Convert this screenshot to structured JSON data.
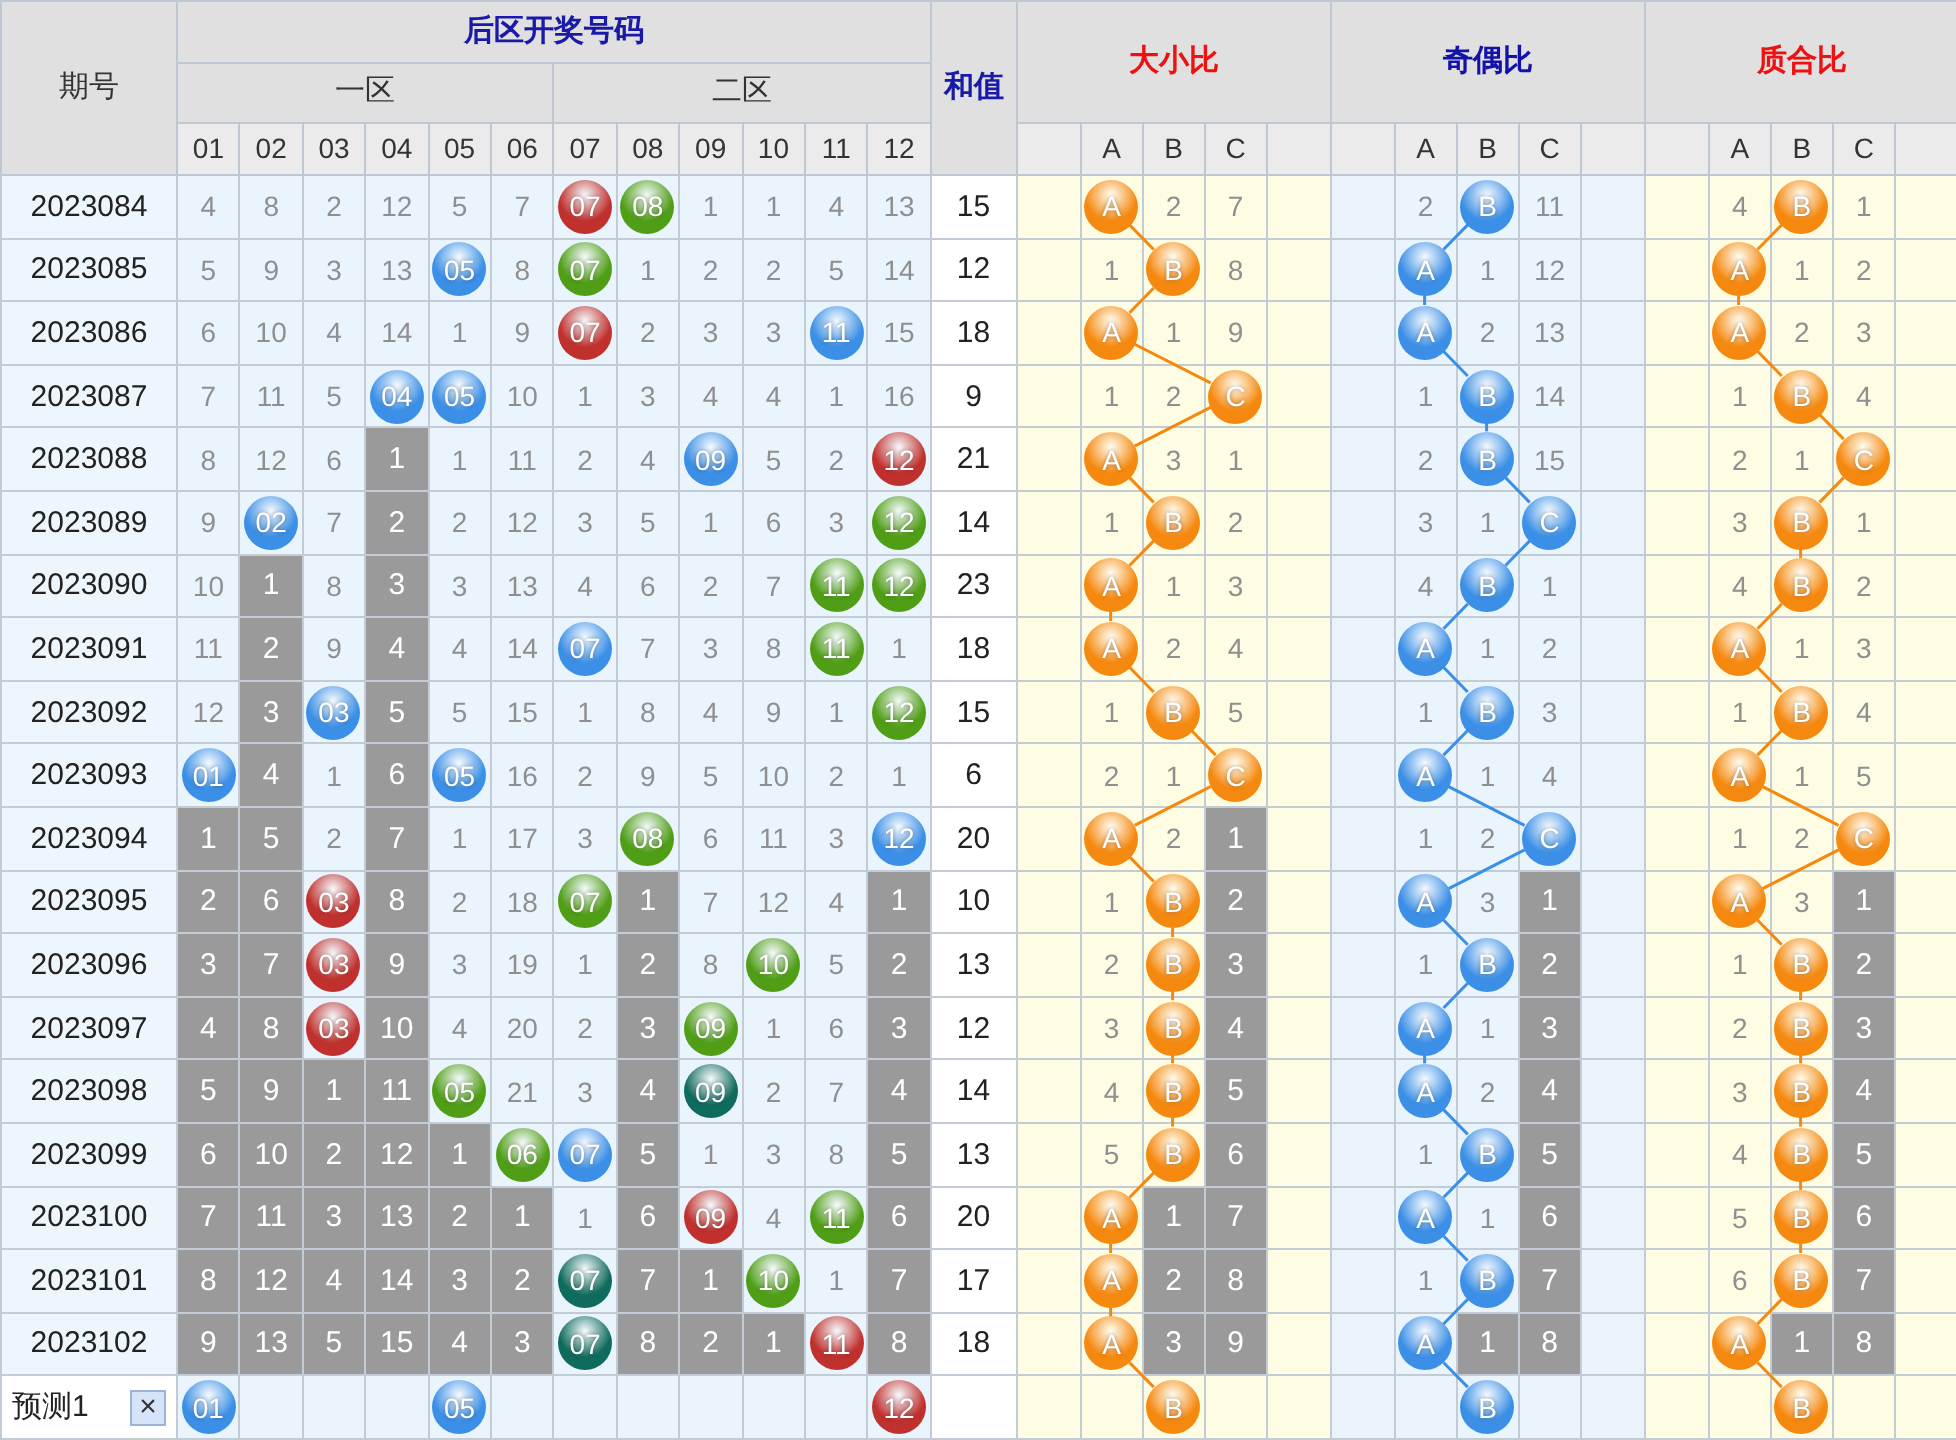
{
  "header": {
    "period": "期号",
    "draw_title": "后区开奖号码",
    "zones": [
      {
        "label": "一区"
      },
      {
        "label": "二区"
      }
    ],
    "numbers": [
      "01",
      "02",
      "03",
      "04",
      "05",
      "06",
      "07",
      "08",
      "09",
      "10",
      "11",
      "12"
    ],
    "sum": "和值"
  },
  "groups": [
    {
      "title": "大小比",
      "kind": "warm",
      "color": "#f5880f",
      "columns": [
        "A",
        "B",
        "C"
      ]
    },
    {
      "title": "奇偶比",
      "kind": "cool",
      "color": "#3b8fe6",
      "columns": [
        "A",
        "B",
        "C"
      ]
    },
    {
      "title": "质合比",
      "kind": "warm",
      "color": "#f5880f",
      "columns": [
        "A",
        "B",
        "C"
      ]
    }
  ],
  "rows": [
    {
      "period": "2023084",
      "cells": [
        {
          "kind": "miss",
          "text": "4"
        },
        {
          "kind": "miss",
          "text": "8"
        },
        {
          "kind": "miss",
          "text": "2"
        },
        {
          "kind": "miss",
          "text": "12"
        },
        {
          "kind": "miss",
          "text": "5"
        },
        {
          "kind": "miss",
          "text": "7"
        },
        {
          "kind": "ball",
          "text": "07",
          "color": "#c0312e"
        },
        {
          "kind": "ball",
          "text": "08",
          "color": "#4f9e16"
        },
        {
          "kind": "miss",
          "text": "1"
        },
        {
          "kind": "miss",
          "text": "1"
        },
        {
          "kind": "miss",
          "text": "4"
        },
        {
          "kind": "miss",
          "text": "13"
        }
      ],
      "sum": "15",
      "ratios": [
        [
          {
            "kind": "ball",
            "text": "A"
          },
          {
            "kind": "miss",
            "text": "2"
          },
          {
            "kind": "miss",
            "text": "7"
          }
        ],
        [
          {
            "kind": "miss",
            "text": "2"
          },
          {
            "kind": "ball",
            "text": "B"
          },
          {
            "kind": "miss",
            "text": "11"
          }
        ],
        [
          {
            "kind": "miss",
            "text": "4"
          },
          {
            "kind": "ball",
            "text": "B"
          },
          {
            "kind": "miss",
            "text": "1"
          }
        ]
      ]
    },
    {
      "period": "2023085",
      "cells": [
        {
          "kind": "miss",
          "text": "5"
        },
        {
          "kind": "miss",
          "text": "9"
        },
        {
          "kind": "miss",
          "text": "3"
        },
        {
          "kind": "miss",
          "text": "13"
        },
        {
          "kind": "ball",
          "text": "05",
          "color": "#3b8fe6"
        },
        {
          "kind": "miss",
          "text": "8"
        },
        {
          "kind": "ball",
          "text": "07",
          "color": "#4f9e16"
        },
        {
          "kind": "miss",
          "text": "1"
        },
        {
          "kind": "miss",
          "text": "2"
        },
        {
          "kind": "miss",
          "text": "2"
        },
        {
          "kind": "miss",
          "text": "5"
        },
        {
          "kind": "miss",
          "text": "14"
        }
      ],
      "sum": "12",
      "ratios": [
        [
          {
            "kind": "miss",
            "text": "1"
          },
          {
            "kind": "ball",
            "text": "B"
          },
          {
            "kind": "miss",
            "text": "8"
          }
        ],
        [
          {
            "kind": "ball",
            "text": "A"
          },
          {
            "kind": "miss",
            "text": "1"
          },
          {
            "kind": "miss",
            "text": "12"
          }
        ],
        [
          {
            "kind": "ball",
            "text": "A"
          },
          {
            "kind": "miss",
            "text": "1"
          },
          {
            "kind": "miss",
            "text": "2"
          }
        ]
      ]
    },
    {
      "period": "2023086",
      "cells": [
        {
          "kind": "miss",
          "text": "6"
        },
        {
          "kind": "miss",
          "text": "10"
        },
        {
          "kind": "miss",
          "text": "4"
        },
        {
          "kind": "miss",
          "text": "14"
        },
        {
          "kind": "miss",
          "text": "1"
        },
        {
          "kind": "miss",
          "text": "9"
        },
        {
          "kind": "ball",
          "text": "07",
          "color": "#c0312e"
        },
        {
          "kind": "miss",
          "text": "2"
        },
        {
          "kind": "miss",
          "text": "3"
        },
        {
          "kind": "miss",
          "text": "3"
        },
        {
          "kind": "ball",
          "text": "11",
          "color": "#3b8fe6"
        },
        {
          "kind": "miss",
          "text": "15"
        }
      ],
      "sum": "18",
      "ratios": [
        [
          {
            "kind": "ball",
            "text": "A"
          },
          {
            "kind": "miss",
            "text": "1"
          },
          {
            "kind": "miss",
            "text": "9"
          }
        ],
        [
          {
            "kind": "ball",
            "text": "A"
          },
          {
            "kind": "miss",
            "text": "2"
          },
          {
            "kind": "miss",
            "text": "13"
          }
        ],
        [
          {
            "kind": "ball",
            "text": "A"
          },
          {
            "kind": "miss",
            "text": "2"
          },
          {
            "kind": "miss",
            "text": "3"
          }
        ]
      ]
    },
    {
      "period": "2023087",
      "cells": [
        {
          "kind": "miss",
          "text": "7"
        },
        {
          "kind": "miss",
          "text": "11"
        },
        {
          "kind": "miss",
          "text": "5"
        },
        {
          "kind": "ball",
          "text": "04",
          "color": "#3b8fe6"
        },
        {
          "kind": "ball",
          "text": "05",
          "color": "#3b8fe6"
        },
        {
          "kind": "miss",
          "text": "10"
        },
        {
          "kind": "miss",
          "text": "1"
        },
        {
          "kind": "miss",
          "text": "3"
        },
        {
          "kind": "miss",
          "text": "4"
        },
        {
          "kind": "miss",
          "text": "4"
        },
        {
          "kind": "miss",
          "text": "1"
        },
        {
          "kind": "miss",
          "text": "16"
        }
      ],
      "sum": "9",
      "ratios": [
        [
          {
            "kind": "miss",
            "text": "1"
          },
          {
            "kind": "miss",
            "text": "2"
          },
          {
            "kind": "ball",
            "text": "C"
          }
        ],
        [
          {
            "kind": "miss",
            "text": "1"
          },
          {
            "kind": "ball",
            "text": "B"
          },
          {
            "kind": "miss",
            "text": "14"
          }
        ],
        [
          {
            "kind": "miss",
            "text": "1"
          },
          {
            "kind": "ball",
            "text": "B"
          },
          {
            "kind": "miss",
            "text": "4"
          }
        ]
      ]
    },
    {
      "period": "2023088",
      "cells": [
        {
          "kind": "miss",
          "text": "8"
        },
        {
          "kind": "miss",
          "text": "12"
        },
        {
          "kind": "miss",
          "text": "6"
        },
        {
          "kind": "streak",
          "text": "1"
        },
        {
          "kind": "miss",
          "text": "1"
        },
        {
          "kind": "miss",
          "text": "11"
        },
        {
          "kind": "miss",
          "text": "2"
        },
        {
          "kind": "miss",
          "text": "4"
        },
        {
          "kind": "ball",
          "text": "09",
          "color": "#3b8fe6"
        },
        {
          "kind": "miss",
          "text": "5"
        },
        {
          "kind": "miss",
          "text": "2"
        },
        {
          "kind": "ball",
          "text": "12",
          "color": "#c0312e"
        }
      ],
      "sum": "21",
      "ratios": [
        [
          {
            "kind": "ball",
            "text": "A"
          },
          {
            "kind": "miss",
            "text": "3"
          },
          {
            "kind": "miss",
            "text": "1"
          }
        ],
        [
          {
            "kind": "miss",
            "text": "2"
          },
          {
            "kind": "ball",
            "text": "B"
          },
          {
            "kind": "miss",
            "text": "15"
          }
        ],
        [
          {
            "kind": "miss",
            "text": "2"
          },
          {
            "kind": "miss",
            "text": "1"
          },
          {
            "kind": "ball",
            "text": "C"
          }
        ]
      ]
    },
    {
      "period": "2023089",
      "cells": [
        {
          "kind": "miss",
          "text": "9"
        },
        {
          "kind": "ball",
          "text": "02",
          "color": "#3b8fe6"
        },
        {
          "kind": "miss",
          "text": "7"
        },
        {
          "kind": "streak",
          "text": "2"
        },
        {
          "kind": "miss",
          "text": "2"
        },
        {
          "kind": "miss",
          "text": "12"
        },
        {
          "kind": "miss",
          "text": "3"
        },
        {
          "kind": "miss",
          "text": "5"
        },
        {
          "kind": "miss",
          "text": "1"
        },
        {
          "kind": "miss",
          "text": "6"
        },
        {
          "kind": "miss",
          "text": "3"
        },
        {
          "kind": "ball",
          "text": "12",
          "color": "#4f9e16"
        }
      ],
      "sum": "14",
      "ratios": [
        [
          {
            "kind": "miss",
            "text": "1"
          },
          {
            "kind": "ball",
            "text": "B"
          },
          {
            "kind": "miss",
            "text": "2"
          }
        ],
        [
          {
            "kind": "miss",
            "text": "3"
          },
          {
            "kind": "miss",
            "text": "1"
          },
          {
            "kind": "ball",
            "text": "C"
          }
        ],
        [
          {
            "kind": "miss",
            "text": "3"
          },
          {
            "kind": "ball",
            "text": "B"
          },
          {
            "kind": "miss",
            "text": "1"
          }
        ]
      ]
    },
    {
      "period": "2023090",
      "cells": [
        {
          "kind": "miss",
          "text": "10"
        },
        {
          "kind": "streak",
          "text": "1"
        },
        {
          "kind": "miss",
          "text": "8"
        },
        {
          "kind": "streak",
          "text": "3"
        },
        {
          "kind": "miss",
          "text": "3"
        },
        {
          "kind": "miss",
          "text": "13"
        },
        {
          "kind": "miss",
          "text": "4"
        },
        {
          "kind": "miss",
          "text": "6"
        },
        {
          "kind": "miss",
          "text": "2"
        },
        {
          "kind": "miss",
          "text": "7"
        },
        {
          "kind": "ball",
          "text": "11",
          "color": "#4f9e16"
        },
        {
          "kind": "ball",
          "text": "12",
          "color": "#4f9e16"
        }
      ],
      "sum": "23",
      "ratios": [
        [
          {
            "kind": "ball",
            "text": "A"
          },
          {
            "kind": "miss",
            "text": "1"
          },
          {
            "kind": "miss",
            "text": "3"
          }
        ],
        [
          {
            "kind": "miss",
            "text": "4"
          },
          {
            "kind": "ball",
            "text": "B"
          },
          {
            "kind": "miss",
            "text": "1"
          }
        ],
        [
          {
            "kind": "miss",
            "text": "4"
          },
          {
            "kind": "ball",
            "text": "B"
          },
          {
            "kind": "miss",
            "text": "2"
          }
        ]
      ]
    },
    {
      "period": "2023091",
      "cells": [
        {
          "kind": "miss",
          "text": "11"
        },
        {
          "kind": "streak",
          "text": "2"
        },
        {
          "kind": "miss",
          "text": "9"
        },
        {
          "kind": "streak",
          "text": "4"
        },
        {
          "kind": "miss",
          "text": "4"
        },
        {
          "kind": "miss",
          "text": "14"
        },
        {
          "kind": "ball",
          "text": "07",
          "color": "#3b8fe6"
        },
        {
          "kind": "miss",
          "text": "7"
        },
        {
          "kind": "miss",
          "text": "3"
        },
        {
          "kind": "miss",
          "text": "8"
        },
        {
          "kind": "ball",
          "text": "11",
          "color": "#4f9e16"
        },
        {
          "kind": "miss",
          "text": "1"
        }
      ],
      "sum": "18",
      "ratios": [
        [
          {
            "kind": "ball",
            "text": "A"
          },
          {
            "kind": "miss",
            "text": "2"
          },
          {
            "kind": "miss",
            "text": "4"
          }
        ],
        [
          {
            "kind": "ball",
            "text": "A"
          },
          {
            "kind": "miss",
            "text": "1"
          },
          {
            "kind": "miss",
            "text": "2"
          }
        ],
        [
          {
            "kind": "ball",
            "text": "A"
          },
          {
            "kind": "miss",
            "text": "1"
          },
          {
            "kind": "miss",
            "text": "3"
          }
        ]
      ]
    },
    {
      "period": "2023092",
      "cells": [
        {
          "kind": "miss",
          "text": "12"
        },
        {
          "kind": "streak",
          "text": "3"
        },
        {
          "kind": "ball",
          "text": "03",
          "color": "#3b8fe6"
        },
        {
          "kind": "streak",
          "text": "5"
        },
        {
          "kind": "miss",
          "text": "5"
        },
        {
          "kind": "miss",
          "text": "15"
        },
        {
          "kind": "miss",
          "text": "1"
        },
        {
          "kind": "miss",
          "text": "8"
        },
        {
          "kind": "miss",
          "text": "4"
        },
        {
          "kind": "miss",
          "text": "9"
        },
        {
          "kind": "miss",
          "text": "1"
        },
        {
          "kind": "ball",
          "text": "12",
          "color": "#4f9e16"
        }
      ],
      "sum": "15",
      "ratios": [
        [
          {
            "kind": "miss",
            "text": "1"
          },
          {
            "kind": "ball",
            "text": "B"
          },
          {
            "kind": "miss",
            "text": "5"
          }
        ],
        [
          {
            "kind": "miss",
            "text": "1"
          },
          {
            "kind": "ball",
            "text": "B"
          },
          {
            "kind": "miss",
            "text": "3"
          }
        ],
        [
          {
            "kind": "miss",
            "text": "1"
          },
          {
            "kind": "ball",
            "text": "B"
          },
          {
            "kind": "miss",
            "text": "4"
          }
        ]
      ]
    },
    {
      "period": "2023093",
      "cells": [
        {
          "kind": "ball",
          "text": "01",
          "color": "#3b8fe6"
        },
        {
          "kind": "streak",
          "text": "4"
        },
        {
          "kind": "miss",
          "text": "1"
        },
        {
          "kind": "streak",
          "text": "6"
        },
        {
          "kind": "ball",
          "text": "05",
          "color": "#3b8fe6"
        },
        {
          "kind": "miss",
          "text": "16"
        },
        {
          "kind": "miss",
          "text": "2"
        },
        {
          "kind": "miss",
          "text": "9"
        },
        {
          "kind": "miss",
          "text": "5"
        },
        {
          "kind": "miss",
          "text": "10"
        },
        {
          "kind": "miss",
          "text": "2"
        },
        {
          "kind": "miss",
          "text": "1"
        }
      ],
      "sum": "6",
      "ratios": [
        [
          {
            "kind": "miss",
            "text": "2"
          },
          {
            "kind": "miss",
            "text": "1"
          },
          {
            "kind": "ball",
            "text": "C"
          }
        ],
        [
          {
            "kind": "ball",
            "text": "A"
          },
          {
            "kind": "miss",
            "text": "1"
          },
          {
            "kind": "miss",
            "text": "4"
          }
        ],
        [
          {
            "kind": "ball",
            "text": "A"
          },
          {
            "kind": "miss",
            "text": "1"
          },
          {
            "kind": "miss",
            "text": "5"
          }
        ]
      ]
    },
    {
      "period": "2023094",
      "cells": [
        {
          "kind": "streak",
          "text": "1"
        },
        {
          "kind": "streak",
          "text": "5"
        },
        {
          "kind": "miss",
          "text": "2"
        },
        {
          "kind": "streak",
          "text": "7"
        },
        {
          "kind": "miss",
          "text": "1"
        },
        {
          "kind": "miss",
          "text": "17"
        },
        {
          "kind": "miss",
          "text": "3"
        },
        {
          "kind": "ball",
          "text": "08",
          "color": "#4f9e16"
        },
        {
          "kind": "miss",
          "text": "6"
        },
        {
          "kind": "miss",
          "text": "11"
        },
        {
          "kind": "miss",
          "text": "3"
        },
        {
          "kind": "ball",
          "text": "12",
          "color": "#3b8fe6"
        }
      ],
      "sum": "20",
      "ratios": [
        [
          {
            "kind": "ball",
            "text": "A"
          },
          {
            "kind": "miss",
            "text": "2"
          },
          {
            "kind": "streak",
            "text": "1"
          }
        ],
        [
          {
            "kind": "miss",
            "text": "1"
          },
          {
            "kind": "miss",
            "text": "2"
          },
          {
            "kind": "ball",
            "text": "C"
          }
        ],
        [
          {
            "kind": "miss",
            "text": "1"
          },
          {
            "kind": "miss",
            "text": "2"
          },
          {
            "kind": "ball",
            "text": "C"
          }
        ]
      ]
    },
    {
      "period": "2023095",
      "cells": [
        {
          "kind": "streak",
          "text": "2"
        },
        {
          "kind": "streak",
          "text": "6"
        },
        {
          "kind": "ball",
          "text": "03",
          "color": "#c0312e"
        },
        {
          "kind": "streak",
          "text": "8"
        },
        {
          "kind": "miss",
          "text": "2"
        },
        {
          "kind": "miss",
          "text": "18"
        },
        {
          "kind": "ball",
          "text": "07",
          "color": "#4f9e16"
        },
        {
          "kind": "streak",
          "text": "1"
        },
        {
          "kind": "miss",
          "text": "7"
        },
        {
          "kind": "miss",
          "text": "12"
        },
        {
          "kind": "miss",
          "text": "4"
        },
        {
          "kind": "streak",
          "text": "1"
        }
      ],
      "sum": "10",
      "ratios": [
        [
          {
            "kind": "miss",
            "text": "1"
          },
          {
            "kind": "ball",
            "text": "B"
          },
          {
            "kind": "streak",
            "text": "2"
          }
        ],
        [
          {
            "kind": "ball",
            "text": "A"
          },
          {
            "kind": "miss",
            "text": "3"
          },
          {
            "kind": "streak",
            "text": "1"
          }
        ],
        [
          {
            "kind": "ball",
            "text": "A"
          },
          {
            "kind": "miss",
            "text": "3"
          },
          {
            "kind": "streak",
            "text": "1"
          }
        ]
      ]
    },
    {
      "period": "2023096",
      "cells": [
        {
          "kind": "streak",
          "text": "3"
        },
        {
          "kind": "streak",
          "text": "7"
        },
        {
          "kind": "ball",
          "text": "03",
          "color": "#c0312e"
        },
        {
          "kind": "streak",
          "text": "9"
        },
        {
          "kind": "miss",
          "text": "3"
        },
        {
          "kind": "miss",
          "text": "19"
        },
        {
          "kind": "miss",
          "text": "1"
        },
        {
          "kind": "streak",
          "text": "2"
        },
        {
          "kind": "miss",
          "text": "8"
        },
        {
          "kind": "ball",
          "text": "10",
          "color": "#4f9e16"
        },
        {
          "kind": "miss",
          "text": "5"
        },
        {
          "kind": "streak",
          "text": "2"
        }
      ],
      "sum": "13",
      "ratios": [
        [
          {
            "kind": "miss",
            "text": "2"
          },
          {
            "kind": "ball",
            "text": "B"
          },
          {
            "kind": "streak",
            "text": "3"
          }
        ],
        [
          {
            "kind": "miss",
            "text": "1"
          },
          {
            "kind": "ball",
            "text": "B"
          },
          {
            "kind": "streak",
            "text": "2"
          }
        ],
        [
          {
            "kind": "miss",
            "text": "1"
          },
          {
            "kind": "ball",
            "text": "B"
          },
          {
            "kind": "streak",
            "text": "2"
          }
        ]
      ]
    },
    {
      "period": "2023097",
      "cells": [
        {
          "kind": "streak",
          "text": "4"
        },
        {
          "kind": "streak",
          "text": "8"
        },
        {
          "kind": "ball",
          "text": "03",
          "color": "#c0312e"
        },
        {
          "kind": "streak",
          "text": "10"
        },
        {
          "kind": "miss",
          "text": "4"
        },
        {
          "kind": "miss",
          "text": "20"
        },
        {
          "kind": "miss",
          "text": "2"
        },
        {
          "kind": "streak",
          "text": "3"
        },
        {
          "kind": "ball",
          "text": "09",
          "color": "#4f9e16"
        },
        {
          "kind": "miss",
          "text": "1"
        },
        {
          "kind": "miss",
          "text": "6"
        },
        {
          "kind": "streak",
          "text": "3"
        }
      ],
      "sum": "12",
      "ratios": [
        [
          {
            "kind": "miss",
            "text": "3"
          },
          {
            "kind": "ball",
            "text": "B"
          },
          {
            "kind": "streak",
            "text": "4"
          }
        ],
        [
          {
            "kind": "ball",
            "text": "A"
          },
          {
            "kind": "miss",
            "text": "1"
          },
          {
            "kind": "streak",
            "text": "3"
          }
        ],
        [
          {
            "kind": "miss",
            "text": "2"
          },
          {
            "kind": "ball",
            "text": "B"
          },
          {
            "kind": "streak",
            "text": "3"
          }
        ]
      ]
    },
    {
      "period": "2023098",
      "cells": [
        {
          "kind": "streak",
          "text": "5"
        },
        {
          "kind": "streak",
          "text": "9"
        },
        {
          "kind": "streak",
          "text": "1"
        },
        {
          "kind": "streak",
          "text": "11"
        },
        {
          "kind": "ball",
          "text": "05",
          "color": "#4f9e16"
        },
        {
          "kind": "miss",
          "text": "21"
        },
        {
          "kind": "miss",
          "text": "3"
        },
        {
          "kind": "streak",
          "text": "4"
        },
        {
          "kind": "ball",
          "text": "09",
          "color": "#0f6b5d"
        },
        {
          "kind": "miss",
          "text": "2"
        },
        {
          "kind": "miss",
          "text": "7"
        },
        {
          "kind": "streak",
          "text": "4"
        }
      ],
      "sum": "14",
      "ratios": [
        [
          {
            "kind": "miss",
            "text": "4"
          },
          {
            "kind": "ball",
            "text": "B"
          },
          {
            "kind": "streak",
            "text": "5"
          }
        ],
        [
          {
            "kind": "ball",
            "text": "A"
          },
          {
            "kind": "miss",
            "text": "2"
          },
          {
            "kind": "streak",
            "text": "4"
          }
        ],
        [
          {
            "kind": "miss",
            "text": "3"
          },
          {
            "kind": "ball",
            "text": "B"
          },
          {
            "kind": "streak",
            "text": "4"
          }
        ]
      ]
    },
    {
      "period": "2023099",
      "cells": [
        {
          "kind": "streak",
          "text": "6"
        },
        {
          "kind": "streak",
          "text": "10"
        },
        {
          "kind": "streak",
          "text": "2"
        },
        {
          "kind": "streak",
          "text": "12"
        },
        {
          "kind": "streak",
          "text": "1"
        },
        {
          "kind": "ball",
          "text": "06",
          "color": "#4f9e16"
        },
        {
          "kind": "ball",
          "text": "07",
          "color": "#3b8fe6"
        },
        {
          "kind": "streak",
          "text": "5"
        },
        {
          "kind": "miss",
          "text": "1"
        },
        {
          "kind": "miss",
          "text": "3"
        },
        {
          "kind": "miss",
          "text": "8"
        },
        {
          "kind": "streak",
          "text": "5"
        }
      ],
      "sum": "13",
      "ratios": [
        [
          {
            "kind": "miss",
            "text": "5"
          },
          {
            "kind": "ball",
            "text": "B"
          },
          {
            "kind": "streak",
            "text": "6"
          }
        ],
        [
          {
            "kind": "miss",
            "text": "1"
          },
          {
            "kind": "ball",
            "text": "B"
          },
          {
            "kind": "streak",
            "text": "5"
          }
        ],
        [
          {
            "kind": "miss",
            "text": "4"
          },
          {
            "kind": "ball",
            "text": "B"
          },
          {
            "kind": "streak",
            "text": "5"
          }
        ]
      ]
    },
    {
      "period": "2023100",
      "cells": [
        {
          "kind": "streak",
          "text": "7"
        },
        {
          "kind": "streak",
          "text": "11"
        },
        {
          "kind": "streak",
          "text": "3"
        },
        {
          "kind": "streak",
          "text": "13"
        },
        {
          "kind": "streak",
          "text": "2"
        },
        {
          "kind": "streak",
          "text": "1"
        },
        {
          "kind": "miss",
          "text": "1"
        },
        {
          "kind": "streak",
          "text": "6"
        },
        {
          "kind": "ball",
          "text": "09",
          "color": "#c0312e"
        },
        {
          "kind": "miss",
          "text": "4"
        },
        {
          "kind": "ball",
          "text": "11",
          "color": "#4f9e16"
        },
        {
          "kind": "streak",
          "text": "6"
        }
      ],
      "sum": "20",
      "ratios": [
        [
          {
            "kind": "ball",
            "text": "A"
          },
          {
            "kind": "streak",
            "text": "1"
          },
          {
            "kind": "streak",
            "text": "7"
          }
        ],
        [
          {
            "kind": "ball",
            "text": "A"
          },
          {
            "kind": "miss",
            "text": "1"
          },
          {
            "kind": "streak",
            "text": "6"
          }
        ],
        [
          {
            "kind": "miss",
            "text": "5"
          },
          {
            "kind": "ball",
            "text": "B"
          },
          {
            "kind": "streak",
            "text": "6"
          }
        ]
      ]
    },
    {
      "period": "2023101",
      "cells": [
        {
          "kind": "streak",
          "text": "8"
        },
        {
          "kind": "streak",
          "text": "12"
        },
        {
          "kind": "streak",
          "text": "4"
        },
        {
          "kind": "streak",
          "text": "14"
        },
        {
          "kind": "streak",
          "text": "3"
        },
        {
          "kind": "streak",
          "text": "2"
        },
        {
          "kind": "ball",
          "text": "07",
          "color": "#0f6b5d"
        },
        {
          "kind": "streak",
          "text": "7"
        },
        {
          "kind": "streak",
          "text": "1"
        },
        {
          "kind": "ball",
          "text": "10",
          "color": "#4f9e16"
        },
        {
          "kind": "miss",
          "text": "1"
        },
        {
          "kind": "streak",
          "text": "7"
        }
      ],
      "sum": "17",
      "ratios": [
        [
          {
            "kind": "ball",
            "text": "A"
          },
          {
            "kind": "streak",
            "text": "2"
          },
          {
            "kind": "streak",
            "text": "8"
          }
        ],
        [
          {
            "kind": "miss",
            "text": "1"
          },
          {
            "kind": "ball",
            "text": "B"
          },
          {
            "kind": "streak",
            "text": "7"
          }
        ],
        [
          {
            "kind": "miss",
            "text": "6"
          },
          {
            "kind": "ball",
            "text": "B"
          },
          {
            "kind": "streak",
            "text": "7"
          }
        ]
      ]
    },
    {
      "period": "2023102",
      "cells": [
        {
          "kind": "streak",
          "text": "9"
        },
        {
          "kind": "streak",
          "text": "13"
        },
        {
          "kind": "streak",
          "text": "5"
        },
        {
          "kind": "streak",
          "text": "15"
        },
        {
          "kind": "streak",
          "text": "4"
        },
        {
          "kind": "streak",
          "text": "3"
        },
        {
          "kind": "ball",
          "text": "07",
          "color": "#0f6b5d"
        },
        {
          "kind": "streak",
          "text": "8"
        },
        {
          "kind": "streak",
          "text": "2"
        },
        {
          "kind": "streak",
          "text": "1"
        },
        {
          "kind": "ball",
          "text": "11",
          "color": "#c0312e"
        },
        {
          "kind": "streak",
          "text": "8"
        }
      ],
      "sum": "18",
      "ratios": [
        [
          {
            "kind": "ball",
            "text": "A"
          },
          {
            "kind": "streak",
            "text": "3"
          },
          {
            "kind": "streak",
            "text": "9"
          }
        ],
        [
          {
            "kind": "ball",
            "text": "A"
          },
          {
            "kind": "streak",
            "text": "1"
          },
          {
            "kind": "streak",
            "text": "8"
          }
        ],
        [
          {
            "kind": "ball",
            "text": "A"
          },
          {
            "kind": "streak",
            "text": "1"
          },
          {
            "kind": "streak",
            "text": "8"
          }
        ]
      ]
    }
  ],
  "forecast": {
    "label": "预测1",
    "close": "×",
    "cells": [
      {
        "kind": "ball",
        "text": "01",
        "color": "#3b8fe6"
      },
      {
        "kind": "empty"
      },
      {
        "kind": "empty"
      },
      {
        "kind": "empty"
      },
      {
        "kind": "ball",
        "text": "05",
        "color": "#3b8fe6"
      },
      {
        "kind": "empty"
      },
      {
        "kind": "empty"
      },
      {
        "kind": "empty"
      },
      {
        "kind": "empty"
      },
      {
        "kind": "empty"
      },
      {
        "kind": "empty"
      },
      {
        "kind": "ball",
        "text": "12",
        "color": "#c0312e"
      }
    ],
    "ratios": [
      [
        {
          "kind": "empty"
        },
        {
          "kind": "ball",
          "text": "B"
        },
        {
          "kind": "empty"
        }
      ],
      [
        {
          "kind": "empty"
        },
        {
          "kind": "ball",
          "text": "B"
        },
        {
          "kind": "empty"
        }
      ],
      [
        {
          "kind": "empty"
        },
        {
          "kind": "ball",
          "text": "B"
        },
        {
          "kind": "empty"
        }
      ]
    ]
  }
}
